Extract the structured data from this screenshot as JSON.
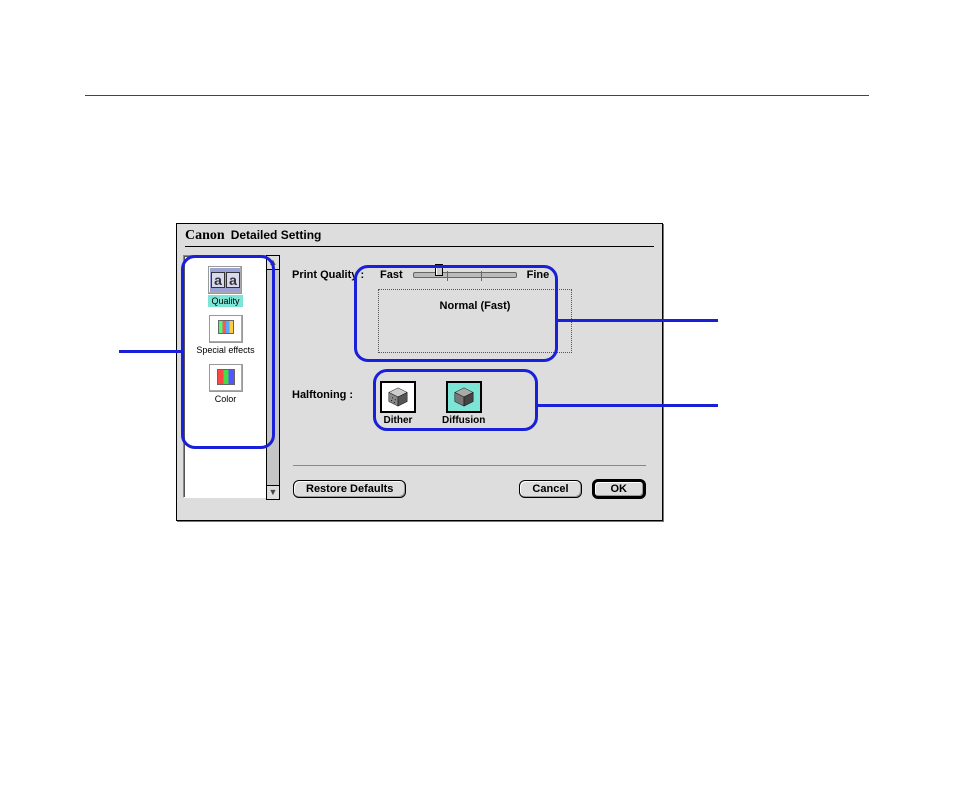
{
  "dialog": {
    "brand": "Canon",
    "title": "Detailed Setting"
  },
  "sidebar": {
    "items": [
      {
        "label": "Quality",
        "selected": true
      },
      {
        "label": "Special effects",
        "selected": false
      },
      {
        "label": "Color",
        "selected": false
      }
    ]
  },
  "quality": {
    "label": "Print Quality :",
    "fast": "Fast",
    "fine": "Fine",
    "current": "Normal (Fast)"
  },
  "halftoning": {
    "label": "Halftoning :",
    "options": [
      {
        "label": "Dither",
        "selected": false
      },
      {
        "label": "Diffusion",
        "selected": true
      }
    ]
  },
  "buttons": {
    "restore": "Restore Defaults",
    "cancel": "Cancel",
    "ok": "OK"
  }
}
